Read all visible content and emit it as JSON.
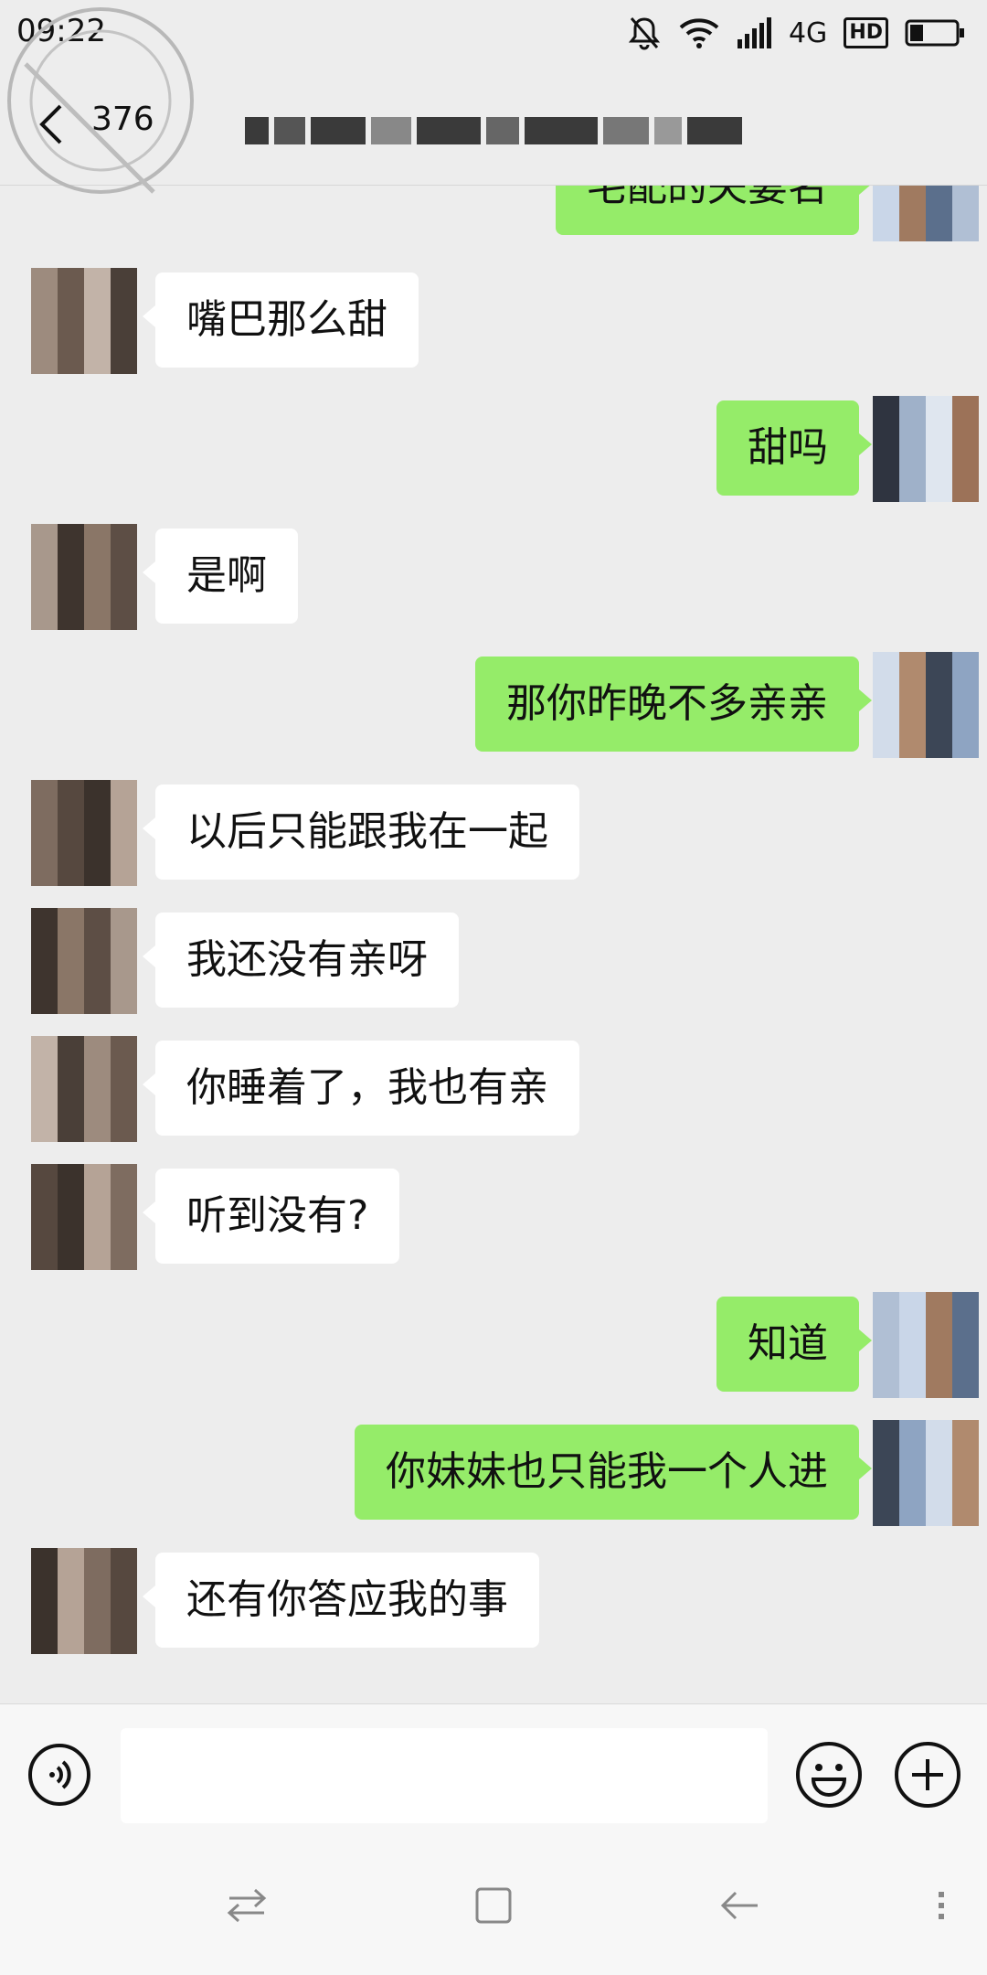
{
  "status_bar": {
    "time": "09:22",
    "network": "4G",
    "hd": "HD",
    "icons": [
      "mute-bell-icon",
      "wifi-icon",
      "signal-icon",
      "battery-icon"
    ]
  },
  "header": {
    "unread_count": "376",
    "title": ""
  },
  "messages": [
    {
      "side": "right",
      "text": "宅配的夫妻名"
    },
    {
      "side": "left",
      "text": "嘴巴那么甜"
    },
    {
      "side": "right",
      "text": "甜吗"
    },
    {
      "side": "left",
      "text": "是啊"
    },
    {
      "side": "right",
      "text": "那你昨晚不多亲亲"
    },
    {
      "side": "left",
      "text": "以后只能跟我在一起"
    },
    {
      "side": "left",
      "text": "我还没有亲呀"
    },
    {
      "side": "left",
      "text": "你睡着了，我也有亲"
    },
    {
      "side": "left",
      "text": "听到没有?"
    },
    {
      "side": "right",
      "text": "知道"
    },
    {
      "side": "right",
      "text": "你妹妹也只能我一个人进"
    },
    {
      "side": "left",
      "text": "还有你答应我的事"
    }
  ],
  "input_bar": {
    "placeholder": "",
    "voice_icon": "voice-icon",
    "emoji_icon": "emoji-icon",
    "plus_icon": "plus-icon"
  },
  "nav_bar": {
    "icons": [
      "switch-icon",
      "home-icon",
      "back-icon",
      "menu-icon"
    ]
  },
  "colors": {
    "background": "#ededed",
    "sent_bubble": "#95ec69",
    "received_bubble": "#ffffff"
  }
}
